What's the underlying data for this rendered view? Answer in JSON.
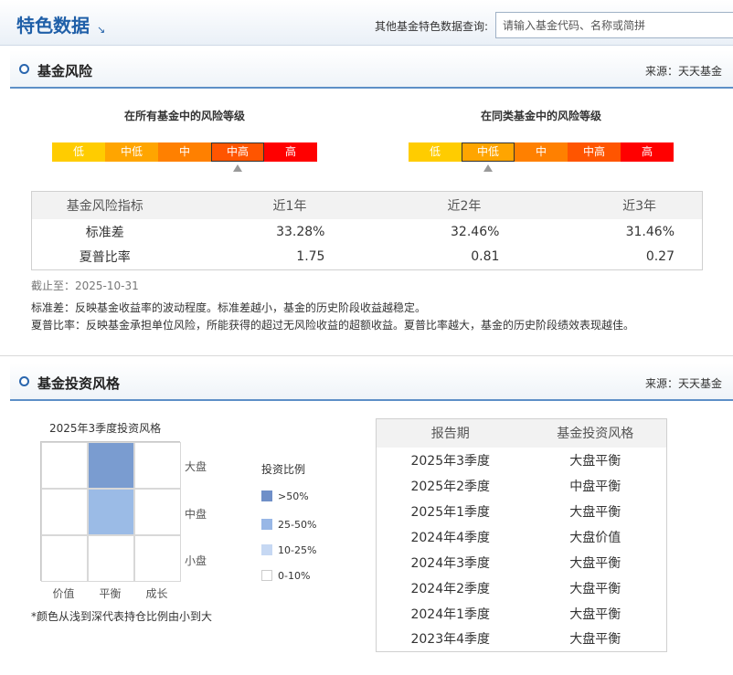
{
  "header": {
    "title": "特色数据",
    "title_arrow": "↘",
    "query_label": "其他基金特色数据查询:",
    "query_placeholder": "请输入基金代码、名称或简拼"
  },
  "risk_section": {
    "title": "基金风险",
    "source": "来源：天天基金",
    "all_funds": {
      "title": "在所有基金中的风险等级",
      "levels": [
        {
          "label": "低",
          "color": "#ffcc00"
        },
        {
          "label": "中低",
          "color": "#ffa500"
        },
        {
          "label": "中",
          "color": "#ff8000"
        },
        {
          "label": "中高",
          "color": "#ff5500"
        },
        {
          "label": "高",
          "color": "#ff0000"
        }
      ],
      "active_index": 3
    },
    "peer_funds": {
      "title": "在同类基金中的风险等级",
      "levels": [
        {
          "label": "低",
          "color": "#ffcc00"
        },
        {
          "label": "中低",
          "color": "#ffa500"
        },
        {
          "label": "中",
          "color": "#ff8000"
        },
        {
          "label": "中高",
          "color": "#ff5500"
        },
        {
          "label": "高",
          "color": "#ff0000"
        }
      ],
      "active_index": 1
    },
    "table": {
      "headers": [
        "基金风险指标",
        "近1年",
        "近2年",
        "近3年"
      ],
      "rows": [
        [
          "标准差",
          "33.28%",
          "32.46%",
          "31.46%"
        ],
        [
          "夏普比率",
          "1.75",
          "0.81",
          "0.27"
        ]
      ]
    },
    "as_of": "截止至：2025-10-31",
    "notes": [
      "标准差：反映基金收益率的波动程度。标准差越小，基金的历史阶段收益越稳定。",
      "夏普比率：反映基金承担单位风险，所能获得的超过无风险收益的超额收益。夏普比率越大，基金的历史阶段绩效表现越佳。"
    ]
  },
  "style_section": {
    "title": "基金投资风格",
    "source": "来源：天天基金",
    "grid_title": "2025年3季度投资风格",
    "row_labels": [
      "大盘",
      "中盘",
      "小盘"
    ],
    "col_labels": [
      "价值",
      "平衡",
      "成长"
    ],
    "grid_colors": [
      [
        "#ffffff",
        "#7a9cd0",
        "#ffffff"
      ],
      [
        "#ffffff",
        "#9bbbe6",
        "#ffffff"
      ],
      [
        "#ffffff",
        "#ffffff",
        "#ffffff"
      ]
    ],
    "legend_title": "投资比例",
    "legend": [
      {
        "label": ">50%",
        "color": "#6f8fc8"
      },
      {
        "label": "25-50%",
        "color": "#98b7e6"
      },
      {
        "label": "10-25%",
        "color": "#c6d8f3"
      },
      {
        "label": "0-10%",
        "color": "#ffffff"
      }
    ],
    "grid_note": "*颜色从浅到深代表持仓比例由小到大",
    "table": {
      "headers": [
        "报告期",
        "基金投资风格"
      ],
      "rows": [
        [
          "2025年3季度",
          "大盘平衡"
        ],
        [
          "2025年2季度",
          "中盘平衡"
        ],
        [
          "2025年1季度",
          "大盘平衡"
        ],
        [
          "2024年4季度",
          "大盘价值"
        ],
        [
          "2024年3季度",
          "大盘平衡"
        ],
        [
          "2024年2季度",
          "大盘平衡"
        ],
        [
          "2024年1季度",
          "大盘平衡"
        ],
        [
          "2023年4季度",
          "大盘平衡"
        ]
      ]
    }
  }
}
